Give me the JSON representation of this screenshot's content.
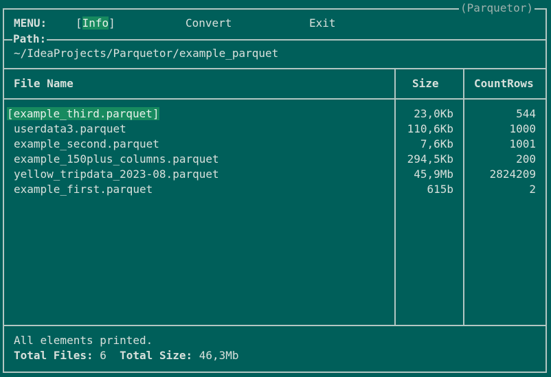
{
  "app": {
    "title": "(Parquetor)"
  },
  "menu": {
    "label": "MENU:",
    "items": [
      {
        "label": "Info",
        "selected": true
      },
      {
        "label": "Convert",
        "selected": false
      },
      {
        "label": "Exit",
        "selected": false
      }
    ]
  },
  "path": {
    "label": "Path:",
    "value": "~/IdeaProjects/Parquetor/example_parquet"
  },
  "table": {
    "headers": {
      "name": "File Name",
      "size": "Size",
      "count": "CountRows"
    },
    "rows": [
      {
        "name": "example_third.parquet",
        "size": "23,0Kb",
        "count": "544",
        "selected": true
      },
      {
        "name": "userdata3.parquet",
        "size": "110,6Kb",
        "count": "1000"
      },
      {
        "name": "example_second.parquet",
        "size": "7,6Kb",
        "count": "1001"
      },
      {
        "name": "example_150plus_columns.parquet",
        "size": "294,5Kb",
        "count": "200"
      },
      {
        "name": "yellow_tripdata_2023-08.parquet",
        "size": "45,9Mb",
        "count": "2824209"
      },
      {
        "name": "example_first.parquet",
        "size": "615b",
        "count": "2"
      }
    ]
  },
  "status": {
    "message": "All elements printed.",
    "total_files_label": "Total Files:",
    "total_files_value": "6",
    "total_size_label": "Total Size:",
    "total_size_value": "46,3Mb"
  },
  "colors": {
    "background": "#005f5a",
    "border": "#b3c7c3",
    "selection": "#178a5f",
    "text": "#d8e0dc"
  }
}
